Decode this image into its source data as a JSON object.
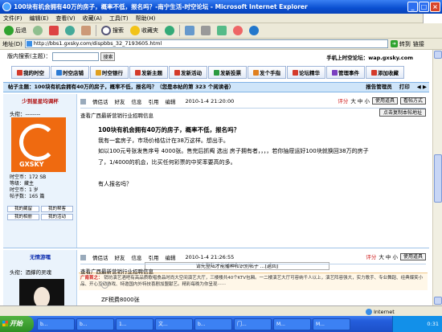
{
  "window": {
    "title": "100块有机会拥有40万的房子，概率不低，报名吗？-南宁生活-时空论坛 - Microsoft Internet Explorer",
    "controls": [
      "_",
      "□",
      "×"
    ]
  },
  "menu": [
    "文件(F)",
    "编辑(E)",
    "查看(V)",
    "收藏(A)",
    "工具(T)",
    "帮助(H)"
  ],
  "toolbar": {
    "back": "后退",
    "forward": "",
    "stop": "",
    "refresh": "",
    "home": "",
    "search": "搜索",
    "favorites": "收藏夹",
    "mail": "",
    "print": ""
  },
  "address": {
    "label": "地址(D)",
    "url": "http://bbs1.gxsky.com/dispbbs_32_7193605.html",
    "go": "转到",
    "links": "链接"
  },
  "forum": {
    "search_label": "版内搜索(主题)：",
    "search_placeholder": "",
    "search_button": "搜索",
    "wap": "手机上时空论坛：wap.gxsky.com",
    "nav": [
      {
        "label": "我的时空",
        "color": "#d43a2a"
      },
      {
        "label": "时空店铺",
        "color": "#2a7ad4"
      },
      {
        "label": "时空银行",
        "color": "#e0a020"
      },
      {
        "label": "发新主题",
        "color": "#d43a2a"
      },
      {
        "label": "发新活动",
        "color": "#d43a2a"
      },
      {
        "label": "发新投票",
        "color": "#2a9a40"
      },
      {
        "label": "发个手指",
        "color": "#e08020"
      },
      {
        "label": "论坛精华",
        "color": "#d43a2a"
      },
      {
        "label": "管理事件",
        "color": "#7a40c0"
      },
      {
        "label": "添加收藏",
        "color": "#d43a2a"
      }
    ],
    "topic_bar": "帖子主题：100块有机会拥有40万的房子，概率不低，报名吗？（您是本帖的第 323 个阅读者）",
    "topic_links": [
      "报告管理员",
      "打印",
      "◀ ▶"
    ]
  },
  "post1": {
    "username": "少到星星均调杯",
    "rank": "头衔：--------",
    "avatar_logo": "GXSKY",
    "info": "时空币：172 SB\n等级：藏主\n时空币：1 岁\n帖子数：165 篇",
    "side_buttons": [
      "我的藏留",
      "我的帮客",
      "我的相册",
      "我的活动"
    ],
    "actions": [
      "情侣话",
      "好友",
      "信息",
      "引用",
      "编辑"
    ],
    "time": "2010-1-4 21:20:00",
    "rating": "评分",
    "size": "大 中 小",
    "use_item": "使用道具",
    "view_mode": "看帖方式",
    "ad_line": "查看广西最新营销行业招聘信息",
    "copy_btn": "点击复制本帖地址",
    "title": "100块有机会拥有40万的房子，概率不低，报名吗？",
    "lines": [
      "我有一套房子，市场价格估计在38万这样。想出手。",
      "如以100元号张发售序号 4000张。售完后抓阄 选出 房子拥有者，，，，若你抽屉运好100块就换回38万的房子",
      "了，1/4000的机会，比买任何彩票的中奖率要高的多。",
      "",
      "有人报名吗？"
    ],
    "seed": "请先登陆才能播种和识别帖子 ...[返回]",
    "ad_label": "广南首之：",
    "ad_text": "销坊演艺酒吧有高品质歌唱食品时尚大空间演艺大厅，三楼楼共40个KTV包厢。一二楼演艺大厅可容纳千人以上，演艺阵容强大，实力歌手、专业舞蹈、经典爆笑小品、开心互动游戏、特邀国内外特技喜剧加盟献艺。精彩每晚为你呈现······"
  },
  "post2": {
    "username": "无情游嘿",
    "rank": "头衔：酒撑的灵魂",
    "actions": [
      "情侣话",
      "好友",
      "信息",
      "引用",
      "编辑"
    ],
    "time": "2010-1-4 21:26:55",
    "rating": "评分",
    "size": "大 中 小",
    "use_item": "使用道具",
    "ad_line": "查看广西最新营销行业招聘信息",
    "line1": "ZF税费8000张"
  },
  "status": {
    "text": "",
    "zone": "Internet"
  },
  "taskbar": {
    "start": "开始",
    "tasks": [
      "b...",
      "b...",
      "1...",
      "文...",
      "b...",
      "门...",
      "M...",
      "M..."
    ],
    "clock": "0:31"
  }
}
